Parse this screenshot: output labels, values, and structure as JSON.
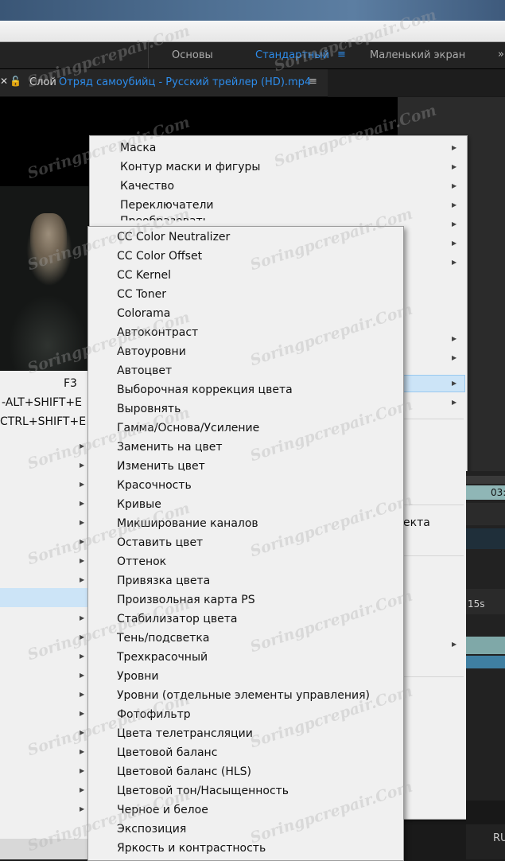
{
  "workspace": {
    "items": [
      "Основы",
      "Стандартный",
      "Маленький экран"
    ],
    "active_index": 1,
    "menu_icon": "hamburger-icon",
    "close_glyph": "»"
  },
  "layer_panel": {
    "label": "Слой",
    "file": "Отряд самоубийц - Русский трейлер (HD).mp4",
    "lock_icon": "lock-icon",
    "menu_icon": "hamburger-icon"
  },
  "left_menu": {
    "shortcuts": [
      "F3",
      "-ALT+SHIFT+E",
      "CTRL+SHIFT+E"
    ]
  },
  "context_menu": {
    "items": [
      "Маска",
      "Контур маски и фигуры",
      "Качество",
      "Переключатели",
      "Преобразовать"
    ],
    "partial_text": "екта"
  },
  "right_panel": {
    "timecode": "03:",
    "duration": "15s",
    "lang": "RU"
  },
  "submenu": {
    "items": [
      "CC Color Neutralizer",
      "CC Color Offset",
      "CC Kernel",
      "CC Toner",
      "Colorama",
      "Автоконтраст",
      "Автоуровни",
      "Автоцвет",
      "Выборочная коррекция цвета",
      "Выровнять",
      "Гамма/Основа/Усиление",
      "Заменить на цвет",
      "Изменить цвет",
      "Красочность",
      "Кривые",
      "Микширование каналов",
      "Оставить цвет",
      "Оттенок",
      "Привязка цвета",
      "Произвольная карта PS",
      "Стабилизатор цвета",
      "Тень/подсветка",
      "Трехкрасочный",
      "Уровни",
      "Уровни (отдельные элементы управления)",
      "Фотофильтр",
      "Цвета телетрансляции",
      "Цветовой баланс",
      "Цветовой баланс (HLS)",
      "Цветовой тон/Насыщенность",
      "Черное и белое",
      "Экспозиция",
      "Яркость и контрастность"
    ]
  },
  "watermark": "Soringpcrepair.Com",
  "colors": {
    "accent": "#2d8ceb",
    "menu_bg": "#f0f0f0",
    "highlight": "#cce4f7"
  }
}
